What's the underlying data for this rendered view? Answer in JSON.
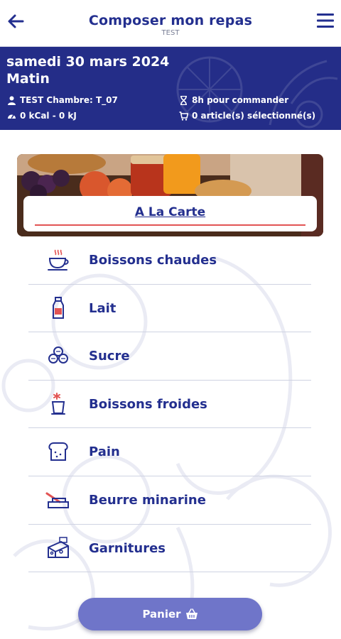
{
  "header": {
    "title": "Composer mon repas",
    "subtitle": "TEST"
  },
  "info": {
    "date": "samedi 30 mars 2024",
    "meal": "Matin",
    "patient": "TEST Chambre: T_07",
    "calories": "0 kCal - 0 kJ",
    "deadline": "8h pour commander",
    "selected": "0 article(s) sélectionné(s)"
  },
  "banner": {
    "label": "A La Carte"
  },
  "categories": [
    {
      "label": "Boissons chaudes",
      "icon": "hot-drink-icon"
    },
    {
      "label": "Lait",
      "icon": "milk-bottle-icon"
    },
    {
      "label": "Sucre",
      "icon": "sugar-cubes-icon"
    },
    {
      "label": "Boissons froides",
      "icon": "cold-drink-icon"
    },
    {
      "label": "Pain",
      "icon": "bread-icon"
    },
    {
      "label": "Beurre minarine",
      "icon": "butter-icon"
    },
    {
      "label": "Garnitures",
      "icon": "cheese-icon"
    }
  ],
  "cart": {
    "label": "Panier"
  },
  "colors": {
    "primary": "#232f8f",
    "band": "#242d88",
    "accent": "#e25454",
    "button": "#6f75c9"
  }
}
